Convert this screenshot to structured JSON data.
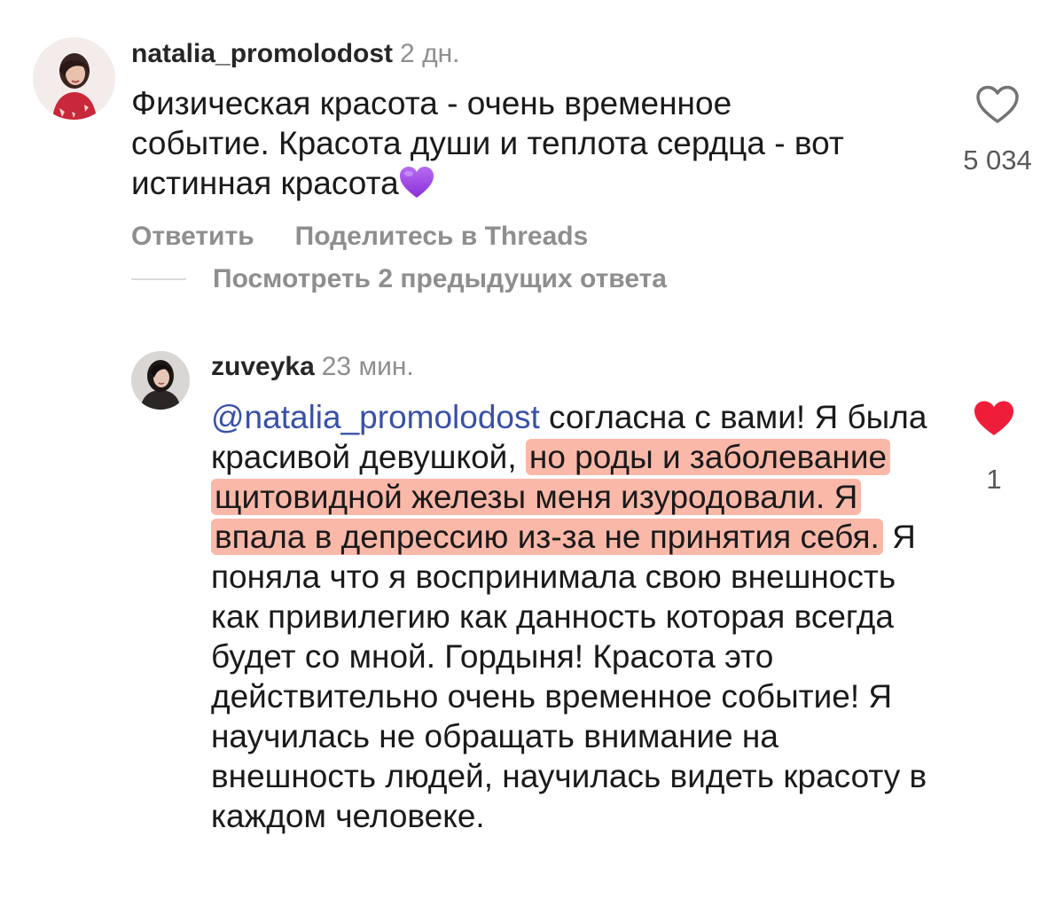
{
  "comment1": {
    "username": "natalia_promolodost",
    "time": "2 дн.",
    "text_line1": "Физическая красота - очень временное",
    "text_line2": "событие. Красота души и теплота сердца - вот",
    "text_line3": "истинная красота",
    "emoji": "purple-heart",
    "like_count": "5 034",
    "like_state": "not-liked",
    "reply_label": "Ответить",
    "share_label": "Поделитесь в Threads",
    "view_replies_label": "Посмотреть 2 предыдущих ответа"
  },
  "comment2": {
    "username": "zuveyka",
    "time": "23 мин.",
    "mention": "@natalia_promolodost",
    "part1": " согласна с вами! Я была красивой девушкой, ",
    "highlighted": "но роды и заболевание щитовидной железы меня изуродовали. Я впала в депрессию из-за не принятия себя.",
    "part2": " Я поняла что я воспринимала свою внешность как привилегию как данность которая всегда будет со мной. Гордыня! Красота это действительно очень временное событие! Я научилась не обращать внимание на внешность людей, научилась видеть красоту в каждом человеке.",
    "like_count": "1",
    "like_state": "liked"
  },
  "colors": {
    "mention": "#3950a8",
    "liked_heart": "#ee1d3a",
    "highlight": "#f8a08c",
    "secondary_text": "#8e8e8e"
  }
}
